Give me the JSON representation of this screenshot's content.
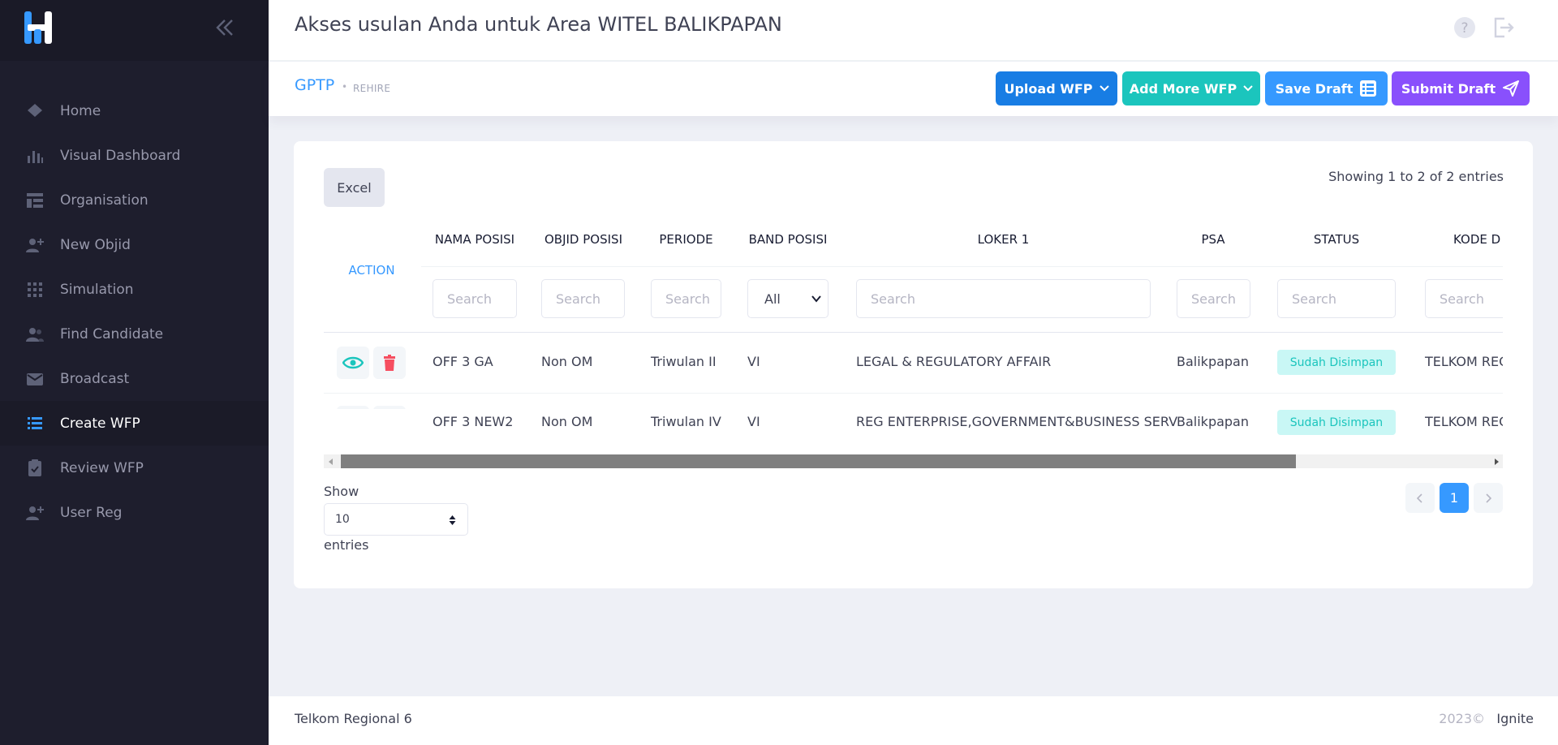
{
  "sidebar": {
    "items": [
      {
        "label": "Home",
        "icon": "home-icon"
      },
      {
        "label": "Visual Dashboard",
        "icon": "chart-icon"
      },
      {
        "label": "Organisation",
        "icon": "organisation-icon"
      },
      {
        "label": "New Objid",
        "icon": "user-plus-icon"
      },
      {
        "label": "Simulation",
        "icon": "grid-icon"
      },
      {
        "label": "Find Candidate",
        "icon": "users-icon"
      },
      {
        "label": "Broadcast",
        "icon": "envelope-icon"
      },
      {
        "label": "Create WFP",
        "icon": "list-icon"
      },
      {
        "label": "Review WFP",
        "icon": "clipboard-check-icon"
      },
      {
        "label": "User Reg",
        "icon": "user-add-icon"
      }
    ],
    "active": "Create WFP"
  },
  "header": {
    "title": "Akses usulan Anda untuk Area WITEL BALIKPAPAN"
  },
  "subheader": {
    "crumb_main": "GPTP",
    "crumb_sub": "REHIRE",
    "upload_label": "Upload WFP",
    "add_more_label": "Add More WFP",
    "save_draft_label": "Save Draft",
    "submit_draft_label": "Submit Draft"
  },
  "table": {
    "excel_label": "Excel",
    "info": "Showing 1 to 2 of 2 entries",
    "action_header": "ACTION",
    "columns": [
      "NAMA POSISI",
      "OBJID POSISI",
      "PERIODE",
      "BAND POSISI",
      "LOKER 1",
      "PSA",
      "STATUS",
      "KODE D"
    ],
    "search_placeholder": "Search",
    "search_placeholder_truncated": "Search",
    "band_filter_value": "All",
    "rows": [
      {
        "nama": "OFF 3 GA",
        "objid": "Non OM",
        "periode": "Triwulan II",
        "band": "VI",
        "loker": "LEGAL & REGULATORY AFFAIR",
        "psa": "Balikpapan",
        "status": "Sudah Disimpan",
        "kode": "TELKOM REG"
      },
      {
        "nama": "OFF 3 NEW2",
        "objid": "Non OM",
        "periode": "Triwulan IV",
        "band": "VI",
        "loker": "REG ENTERPRISE,GOVERNMENT&BUSINESS SERV",
        "psa": "Balikpapan",
        "status": "Sudah Disimpan",
        "kode": "TELKOM REG"
      }
    ],
    "show_label": "Show",
    "page_length": "10",
    "entries_label": "entries",
    "current_page": "1"
  },
  "footer": {
    "org": "Telkom Regional 6",
    "year": "2023©",
    "brand": "Ignite"
  },
  "colors": {
    "sidebar_bg": "#1e1e2d",
    "primary": "#3699ff",
    "upload_btn": "#187de4",
    "add_more_btn": "#1bc5bd",
    "submit_btn": "#8950fc",
    "danger": "#f64e60"
  }
}
